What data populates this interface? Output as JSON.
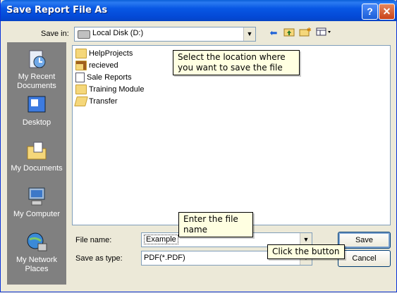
{
  "window": {
    "title": "Save Report File As"
  },
  "titlebar": {
    "help_glyph": "?",
    "close_glyph": "✕"
  },
  "save_in": {
    "label": "Save in:",
    "value": "Local Disk (D:)"
  },
  "places": [
    {
      "label": "My Recent Documents",
      "icon": "recent-documents-icon"
    },
    {
      "label": "Desktop",
      "icon": "desktop-icon"
    },
    {
      "label": "My Documents",
      "icon": "my-documents-icon"
    },
    {
      "label": "My Computer",
      "icon": "my-computer-icon"
    },
    {
      "label": "My Network Places",
      "icon": "network-places-icon"
    }
  ],
  "files": [
    {
      "name": "HelpProjects",
      "type": "folder"
    },
    {
      "name": "recieved",
      "type": "folder-shortcut"
    },
    {
      "name": "Sale Reports",
      "type": "file"
    },
    {
      "name": "Training Module",
      "type": "folder"
    },
    {
      "name": "Transfer",
      "type": "folder-open"
    }
  ],
  "callouts": {
    "location": "Select the location where you want to save the file",
    "filename": "Enter the file name",
    "button": "Click the button"
  },
  "form": {
    "file_name_label": "File name:",
    "file_name_value": "Example",
    "save_as_type_label": "Save as type:",
    "save_as_type_value": "PDF(*.PDF)"
  },
  "buttons": {
    "save": "Save",
    "cancel": "Cancel"
  },
  "colors": {
    "titlebar": "#0857e4",
    "dialog": "#ece9d8",
    "places_bar": "#808080",
    "tooltip": "#ffffe1"
  }
}
